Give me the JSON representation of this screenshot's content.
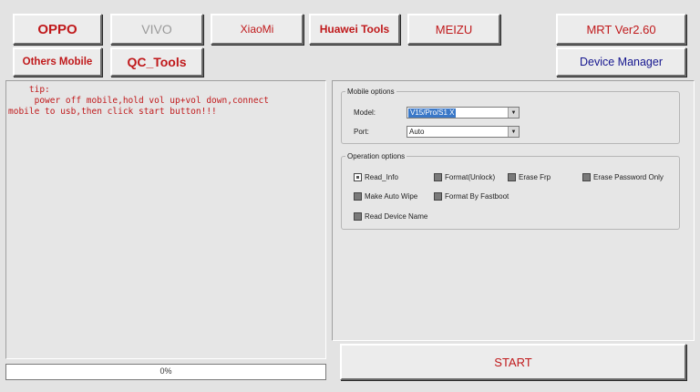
{
  "toolbar": {
    "oppo": "OPPO",
    "vivo": "VIVO",
    "xiaomi": "XiaoMi",
    "huawei_tools": "Huawei Tools",
    "meizu": "MEIZU",
    "mrt_version": "MRT Ver2.60",
    "others_mobile": "Others Mobile",
    "qc_tools": "QC_Tools",
    "device_manager": "Device Manager"
  },
  "log": {
    "text": "    tip:\n     power off mobile,hold vol up+vol down,connect\nmobile to usb,then click start button!!!"
  },
  "progress": {
    "label": "0%",
    "value": 0
  },
  "mobile_options": {
    "legend": "Mobile options",
    "model_label": "Model:",
    "model_value": "V15/Pro/S1 X",
    "port_label": "Port:",
    "port_value": "Auto"
  },
  "operation_options": {
    "legend": "Operation options",
    "read_info": "Read_Info",
    "format_unlock": "Format(Unlock)",
    "erase_frp": "Erase Frp",
    "erase_password_only": "Erase Password Only",
    "make_auto_wipe": "Make Auto Wipe",
    "format_by_fastboot": "Format By Fastboot",
    "read_device_name": "Read Device Name"
  },
  "start_label": "START",
  "colors": {
    "red_text": "#c0191b",
    "blue_text": "#15168f",
    "disabled_text": "#9a9a9a"
  }
}
